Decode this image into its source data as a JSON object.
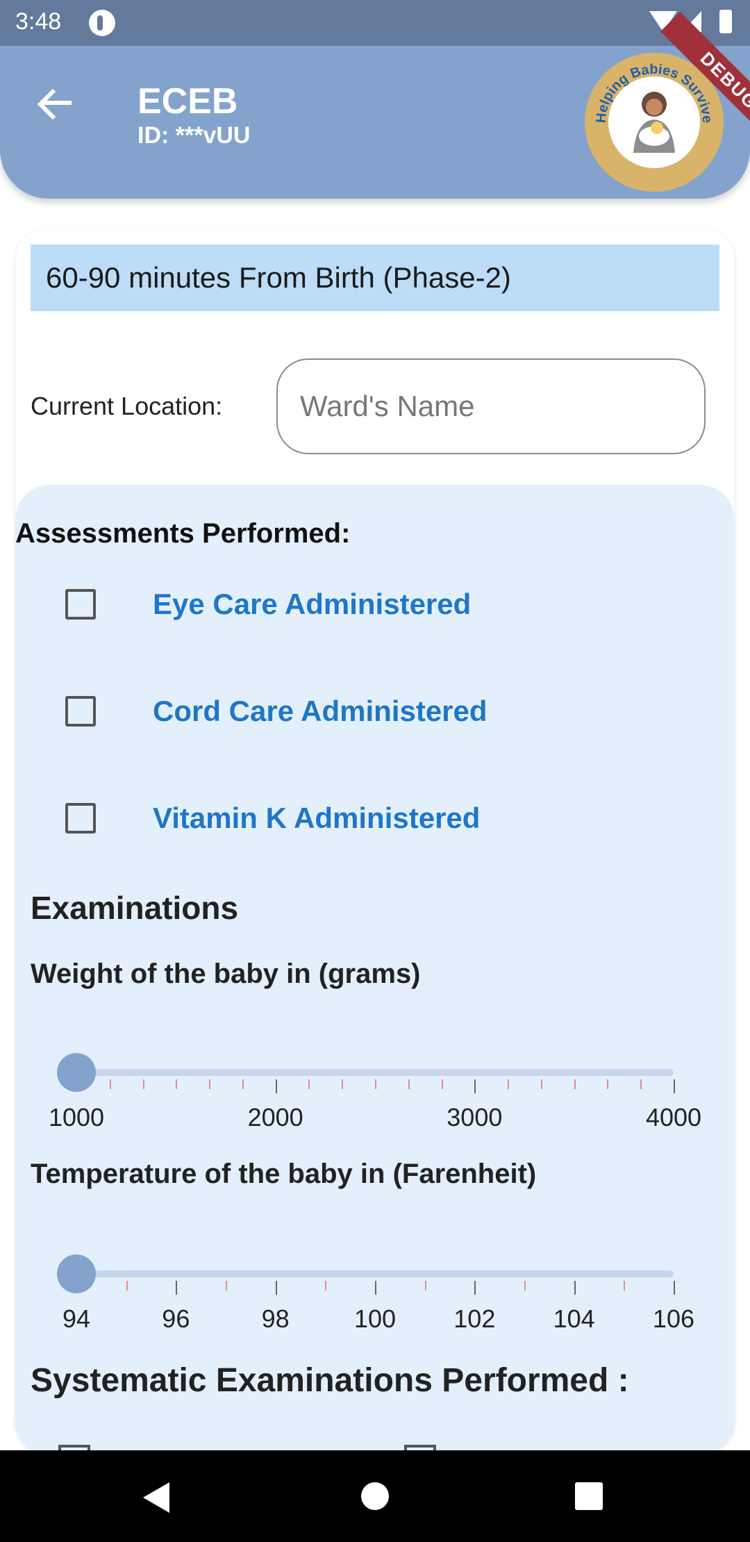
{
  "status_bar": {
    "time": "3:48",
    "icons": [
      "notification-icon",
      "wifi-icon",
      "signal-icon",
      "battery-icon"
    ]
  },
  "app_bar": {
    "title": "ECEB",
    "subtitle": "ID: ***vUU",
    "back_icon": "arrow-back-icon",
    "logo_text": "Helping Babies Survive",
    "debug_banner": "DEBUG",
    "color": "#83a3cd"
  },
  "form": {
    "phase_title": "60-90 minutes From Birth (Phase-2)",
    "location_label": "Current Location:",
    "location_placeholder": "Ward's Name",
    "location_value": "",
    "assessments_title": "Assessments Performed:",
    "assessments": [
      {
        "label": "Eye Care Administered",
        "checked": false
      },
      {
        "label": "Cord Care Administered",
        "checked": false
      },
      {
        "label": "Vitamin K Administered",
        "checked": false
      }
    ],
    "examinations_title": "Examinations",
    "weight": {
      "label": "Weight of the baby in (grams)",
      "min": 1000,
      "max": 4000,
      "value": 1000,
      "tick_labels": [
        "1000",
        "2000",
        "3000",
        "4000"
      ]
    },
    "temperature": {
      "label": "Temperature of the baby in (Farenheit)",
      "min": 94,
      "max": 106,
      "value": 94,
      "tick_labels": [
        "94",
        "96",
        "98",
        "100",
        "102",
        "104",
        "106"
      ]
    },
    "systematic_title": "Systematic Examinations Performed :"
  },
  "colors": {
    "accent_blue": "#1f76c8",
    "phase_banner_bg": "#bcdcf8",
    "panel_bg": "#e3f0fc"
  }
}
